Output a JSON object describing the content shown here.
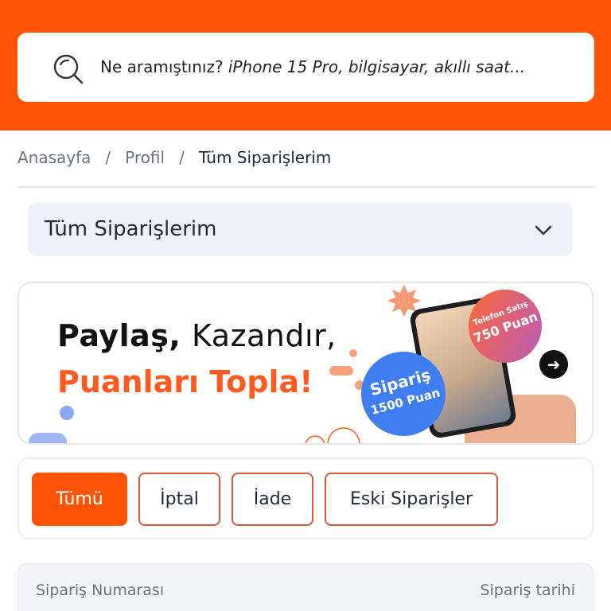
{
  "search": {
    "prompt": "Ne aramıştınız?",
    "example": "iPhone 15 Pro, bilgisayar, akıllı saat..."
  },
  "breadcrumb": {
    "items": [
      "Anasayfa",
      "Profil",
      "Tüm Siparişlerim"
    ],
    "separator": "/"
  },
  "order_filter_dropdown": {
    "selected": "Tüm Siparişlerim"
  },
  "banner": {
    "headline_bold": "Paylaş,",
    "headline_light": "Kazandır,",
    "headline_accent": "Puanları Topla!",
    "badge_order_title": "Sipariş",
    "badge_order_points": "1500 Puan",
    "badge_phone_title": "Telefon Satış",
    "badge_phone_points": "750 Puan"
  },
  "filter_tabs": [
    "Tümü",
    "İptal",
    "İade",
    "Eski Siparişler"
  ],
  "orders_table": {
    "columns": [
      "Sipariş Numarası",
      "Sipariş tarihi"
    ]
  },
  "colors": {
    "brand": "#ff5405",
    "accent_text": "#ff5a1f",
    "tab_border": "#d05a3a",
    "badge_blue": "#3f7ef0"
  }
}
